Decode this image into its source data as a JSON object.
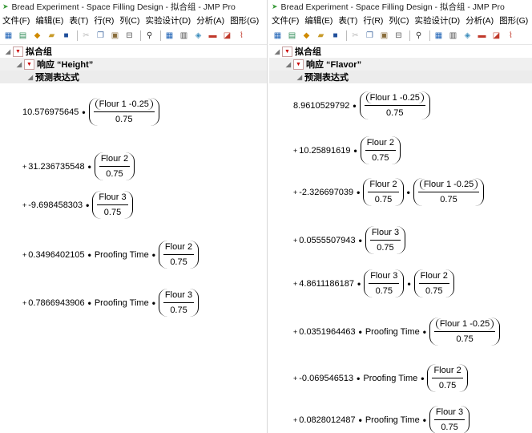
{
  "left": {
    "title": "Bread Experiment - Space Filling Design - 拟合组 - JMP Pro",
    "menu": [
      "文件(F)",
      "编辑(E)",
      "表(T)",
      "行(R)",
      "列(C)",
      "实验设计(D)",
      "分析(A)",
      "图形(G)"
    ],
    "fit_group_label": "拟合组",
    "response_label": "响应 “Height”",
    "formula_label": "预测表达式",
    "terms": [
      {
        "prefix": "",
        "coef": "10.576975645",
        "factors": [
          {
            "num": "Flour 1 -0.25",
            "den": "0.75",
            "nested": true
          }
        ]
      },
      {
        "prefix": "+",
        "coef": "31.236735548",
        "factors": [
          {
            "num": "Flour 2",
            "den": "0.75",
            "nested": false
          }
        ]
      },
      {
        "prefix": "+",
        "coef": "-9.698458303",
        "factors": [
          {
            "num": "Flour 3",
            "den": "0.75",
            "nested": false
          }
        ]
      },
      {
        "prefix": "+",
        "coef": "0.3496402105",
        "var": "Proofing Time",
        "factors": [
          {
            "num": "Flour 2",
            "den": "0.75",
            "nested": false
          }
        ]
      },
      {
        "prefix": "+",
        "coef": "0.7866943906",
        "var": "Proofing Time",
        "factors": [
          {
            "num": "Flour 3",
            "den": "0.75",
            "nested": false
          }
        ]
      }
    ]
  },
  "right": {
    "title": "Bread Experiment - Space Filling Design - 拟合组 - JMP Pro",
    "menu": [
      "文件(F)",
      "编辑(E)",
      "表(T)",
      "行(R)",
      "列(C)",
      "实验设计(D)",
      "分析(A)",
      "图形(G)"
    ],
    "fit_group_label": "拟合组",
    "response_label": "响应 “Flavor”",
    "formula_label": "预测表达式",
    "terms": [
      {
        "prefix": "",
        "coef": "8.9610529792",
        "factors": [
          {
            "num": "Flour 1 -0.25",
            "den": "0.75",
            "nested": true
          }
        ]
      },
      {
        "prefix": "+",
        "coef": "10.25891619",
        "factors": [
          {
            "num": "Flour 2",
            "den": "0.75",
            "nested": false
          }
        ]
      },
      {
        "prefix": "+",
        "coef": "-2.326697039",
        "factors": [
          {
            "num": "Flour 2",
            "den": "0.75",
            "nested": false
          },
          {
            "num": "Flour 1 -0.25",
            "den": "0.75",
            "nested": true
          }
        ]
      },
      {
        "prefix": "+",
        "coef": "0.0555507943",
        "factors": [
          {
            "num": "Flour 3",
            "den": "0.75",
            "nested": false
          }
        ]
      },
      {
        "prefix": "+",
        "coef": "4.8611186187",
        "factors": [
          {
            "num": "Flour 3",
            "den": "0.75",
            "nested": false
          },
          {
            "num": "Flour 2",
            "den": "0.75",
            "nested": false
          }
        ]
      },
      {
        "prefix": "+",
        "coef": "0.0351964463",
        "var": "Proofing Time",
        "factors": [
          {
            "num": "Flour 1 -0.25",
            "den": "0.75",
            "nested": true
          }
        ]
      },
      {
        "prefix": "+",
        "coef": "-0.069546513",
        "var": "Proofing Time",
        "factors": [
          {
            "num": "Flour 2",
            "den": "0.75",
            "nested": false
          }
        ]
      },
      {
        "prefix": "+",
        "coef": "0.0828012487",
        "var": "Proofing Time",
        "factors": [
          {
            "num": "Flour 3",
            "den": "0.75",
            "nested": false
          }
        ]
      }
    ]
  },
  "toolbar_icons": [
    "data-table-icon",
    "new-icon",
    "script-icon",
    "open-icon",
    "save-icon",
    "cut-icon",
    "copy-icon",
    "paste-icon",
    "report-icon",
    "search-icon",
    "grid-icon",
    "bar-chart-icon",
    "fit-icon",
    "graph-icon",
    "ruler-icon",
    "distribution-icon"
  ],
  "colors": {
    "disclosure_red": "#cc0000",
    "header_gray": "#ececec",
    "app_icon": "#3a9a3a"
  }
}
